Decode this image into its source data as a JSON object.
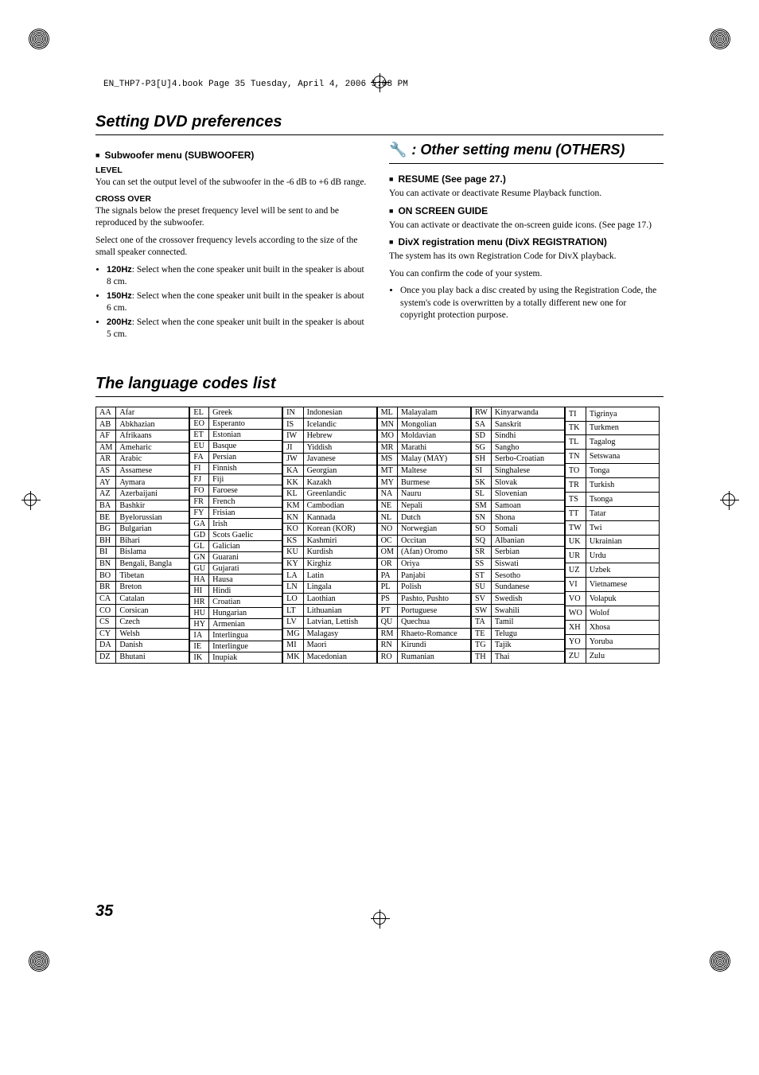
{
  "header_line": "EN_THP7-P3[U]4.book  Page 35  Tuesday, April 4, 2006  5:08 PM",
  "title": "Setting DVD preferences",
  "subwoofer": {
    "heading": "Subwoofer menu (SUBWOOFER)",
    "level_h": "LEVEL",
    "level_p": "You can set the output level of the subwoofer in the -6 dB to +6 dB range.",
    "cross_h": "CROSS OVER",
    "cross_p1": "The signals below the preset frequency level will be sent to and be reproduced by the subwoofer.",
    "cross_p2": "Select one of the crossover frequency levels according to the size of the small speaker connected.",
    "items": [
      {
        "b": "120Hz",
        "t": ": Select when the cone speaker unit built in the speaker is about 8 cm."
      },
      {
        "b": "150Hz",
        "t": ": Select when the cone speaker unit built in the speaker is about 6 cm."
      },
      {
        "b": "200Hz",
        "t": ": Select when the cone speaker unit built in the speaker is about 5 cm."
      }
    ]
  },
  "others": {
    "title": ": Other setting menu (OTHERS)",
    "resume_h": "RESUME (See page 27.)",
    "resume_p": "You can activate or deactivate Resume Playback function.",
    "osg_h": "ON SCREEN GUIDE",
    "osg_p": "You can activate or deactivate the on-screen guide icons. (See page 17.)",
    "divx_h": "DivX registration menu (DivX REGISTRATION)",
    "divx_p1": "The system has its own Registration Code for DivX playback.",
    "divx_p2": "You can confirm the code of your system.",
    "divx_li": "Once you play back a disc created by using the Registration Code, the system's code is overwritten by a totally different new one for copyright protection purpose."
  },
  "lang_title": "The language codes list",
  "langs": [
    [
      [
        "AA",
        "Afar"
      ],
      [
        "AB",
        "Abkhazian"
      ],
      [
        "AF",
        "Afrikaans"
      ],
      [
        "AM",
        "Ameharic"
      ],
      [
        "AR",
        "Arabic"
      ],
      [
        "AS",
        "Assamese"
      ],
      [
        "AY",
        "Aymara"
      ],
      [
        "AZ",
        "Azerbaijani"
      ],
      [
        "BA",
        "Bashkir"
      ],
      [
        "BE",
        "Byelorussian"
      ],
      [
        "BG",
        "Bulgarian"
      ],
      [
        "BH",
        "Bihari"
      ],
      [
        "BI",
        "Bislama"
      ],
      [
        "BN",
        "Bengali, Bangla"
      ],
      [
        "BO",
        "Tibetan"
      ],
      [
        "BR",
        "Breton"
      ],
      [
        "CA",
        "Catalan"
      ],
      [
        "CO",
        "Corsican"
      ],
      [
        "CS",
        "Czech"
      ],
      [
        "CY",
        "Welsh"
      ],
      [
        "DA",
        "Danish"
      ],
      [
        "DZ",
        "Bhutani"
      ]
    ],
    [
      [
        "EL",
        "Greek"
      ],
      [
        "EO",
        "Esperanto"
      ],
      [
        "ET",
        "Estonian"
      ],
      [
        "EU",
        "Basque"
      ],
      [
        "FA",
        "Persian"
      ],
      [
        "FI",
        "Finnish"
      ],
      [
        "FJ",
        "Fiji"
      ],
      [
        "FO",
        "Faroese"
      ],
      [
        "FR",
        "French"
      ],
      [
        "FY",
        "Frisian"
      ],
      [
        "GA",
        "Irish"
      ],
      [
        "GD",
        "Scots Gaelic"
      ],
      [
        "GL",
        "Galician"
      ],
      [
        "GN",
        "Guarani"
      ],
      [
        "GU",
        "Gujarati"
      ],
      [
        "HA",
        "Hausa"
      ],
      [
        "HI",
        "Hindi"
      ],
      [
        "HR",
        "Croatian"
      ],
      [
        "HU",
        "Hungarian"
      ],
      [
        "HY",
        "Armenian"
      ],
      [
        "IA",
        "Interlingua"
      ],
      [
        "IE",
        "Interlingue"
      ],
      [
        "IK",
        "Inupiak"
      ]
    ],
    [
      [
        "IN",
        "Indonesian"
      ],
      [
        "IS",
        "Icelandic"
      ],
      [
        "IW",
        "Hebrew"
      ],
      [
        "JI",
        "Yiddish"
      ],
      [
        "JW",
        "Javanese"
      ],
      [
        "KA",
        "Georgian"
      ],
      [
        "KK",
        "Kazakh"
      ],
      [
        "KL",
        "Greenlandic"
      ],
      [
        "KM",
        "Cambodian"
      ],
      [
        "KN",
        "Kannada"
      ],
      [
        "KO",
        "Korean (KOR)"
      ],
      [
        "KS",
        "Kashmiri"
      ],
      [
        "KU",
        "Kurdish"
      ],
      [
        "KY",
        "Kirghiz"
      ],
      [
        "LA",
        "Latin"
      ],
      [
        "LN",
        "Lingala"
      ],
      [
        "LO",
        "Laothian"
      ],
      [
        "LT",
        "Lithuanian"
      ],
      [
        "LV",
        "Latvian, Lettish"
      ],
      [
        "MG",
        "Malagasy"
      ],
      [
        "MI",
        "Maori"
      ],
      [
        "MK",
        "Macedonian"
      ]
    ],
    [
      [
        "ML",
        "Malayalam"
      ],
      [
        "MN",
        "Mongolian"
      ],
      [
        "MO",
        "Moldavian"
      ],
      [
        "MR",
        "Marathi"
      ],
      [
        "MS",
        "Malay (MAY)"
      ],
      [
        "MT",
        "Maltese"
      ],
      [
        "MY",
        "Burmese"
      ],
      [
        "NA",
        "Nauru"
      ],
      [
        "NE",
        "Nepali"
      ],
      [
        "NL",
        "Dutch"
      ],
      [
        "NO",
        "Norwegian"
      ],
      [
        "OC",
        "Occitan"
      ],
      [
        "OM",
        "(Afan) Oromo"
      ],
      [
        "OR",
        "Oriya"
      ],
      [
        "PA",
        "Panjabi"
      ],
      [
        "PL",
        "Polish"
      ],
      [
        "PS",
        "Pashto, Pushto"
      ],
      [
        "PT",
        "Portuguese"
      ],
      [
        "QU",
        "Quechua"
      ],
      [
        "RM",
        "Rhaeto-Romance"
      ],
      [
        "RN",
        "Kirundi"
      ],
      [
        "RO",
        "Rumanian"
      ]
    ],
    [
      [
        "RW",
        "Kinyarwanda"
      ],
      [
        "SA",
        "Sanskrit"
      ],
      [
        "SD",
        "Sindhi"
      ],
      [
        "SG",
        "Sangho"
      ],
      [
        "SH",
        "Serbo-Croatian"
      ],
      [
        "SI",
        "Singhalese"
      ],
      [
        "SK",
        "Slovak"
      ],
      [
        "SL",
        "Slovenian"
      ],
      [
        "SM",
        "Samoan"
      ],
      [
        "SN",
        "Shona"
      ],
      [
        "SO",
        "Somali"
      ],
      [
        "SQ",
        "Albanian"
      ],
      [
        "SR",
        "Serbian"
      ],
      [
        "SS",
        "Siswati"
      ],
      [
        "ST",
        "Sesotho"
      ],
      [
        "SU",
        "Sundanese"
      ],
      [
        "SV",
        "Swedish"
      ],
      [
        "SW",
        "Swahili"
      ],
      [
        "TA",
        "Tamil"
      ],
      [
        "TE",
        "Telugu"
      ],
      [
        "TG",
        "Tajik"
      ],
      [
        "TH",
        "Thai"
      ]
    ],
    [
      [
        "TI",
        "Tigrinya"
      ],
      [
        "TK",
        "Turkmen"
      ],
      [
        "TL",
        "Tagalog"
      ],
      [
        "TN",
        "Setswana"
      ],
      [
        "TO",
        "Tonga"
      ],
      [
        "TR",
        "Turkish"
      ],
      [
        "TS",
        "Tsonga"
      ],
      [
        "TT",
        "Tatar"
      ],
      [
        "TW",
        "Twi"
      ],
      [
        "UK",
        "Ukrainian"
      ],
      [
        "UR",
        "Urdu"
      ],
      [
        "UZ",
        "Uzbek"
      ],
      [
        "VI",
        "Vietnamese"
      ],
      [
        "VO",
        "Volapuk"
      ],
      [
        "WO",
        "Wolof"
      ],
      [
        "XH",
        "Xhosa"
      ],
      [
        "YO",
        "Yoruba"
      ],
      [
        "ZU",
        "Zulu"
      ]
    ]
  ],
  "page_num": "35"
}
